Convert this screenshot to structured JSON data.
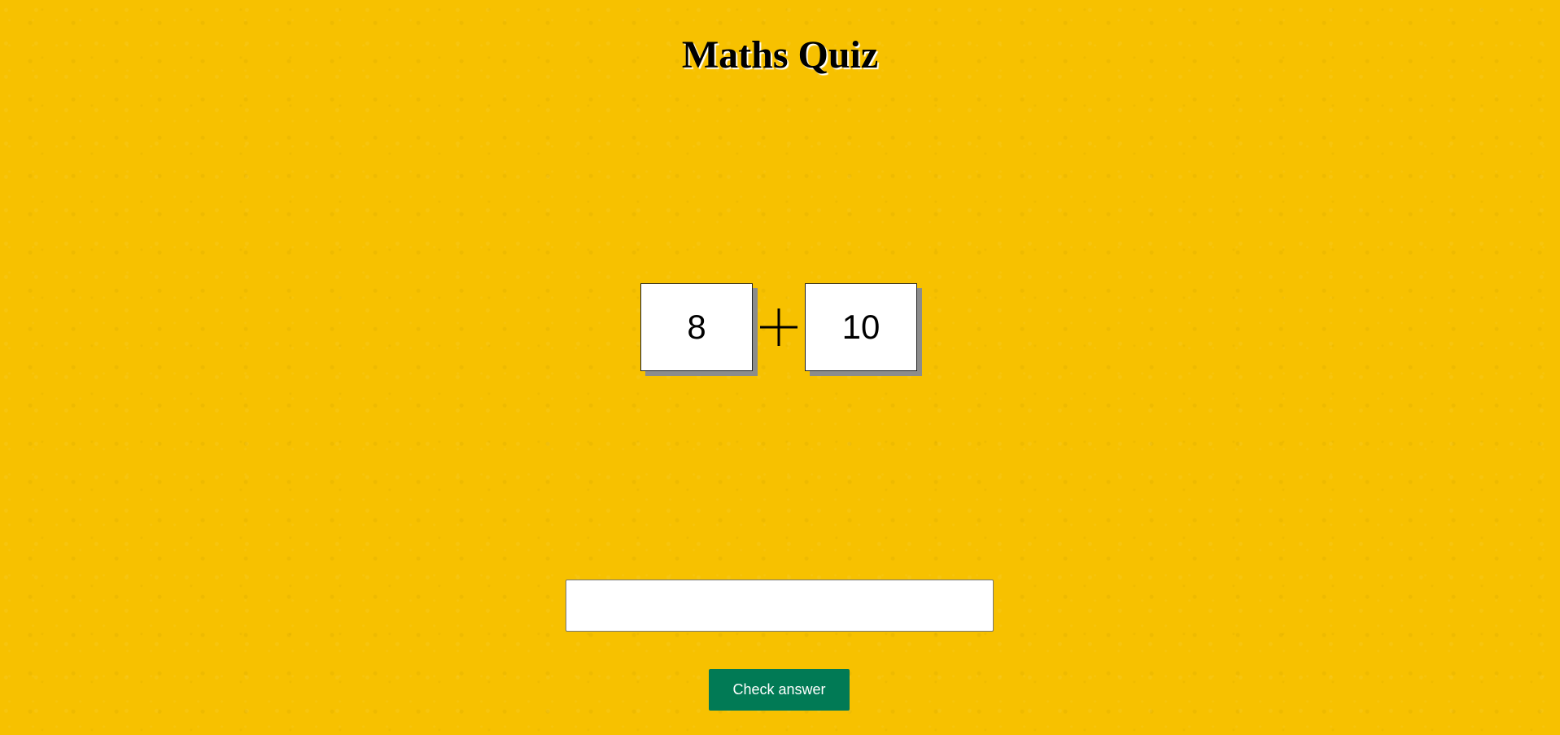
{
  "header": {
    "title": "Maths Quiz"
  },
  "question": {
    "left_operand": "8",
    "operator": "plus",
    "right_operand": "10"
  },
  "answer": {
    "value": "",
    "placeholder": ""
  },
  "actions": {
    "check_label": "Check answer"
  },
  "colors": {
    "background": "#f7c100",
    "button": "#017a55"
  }
}
